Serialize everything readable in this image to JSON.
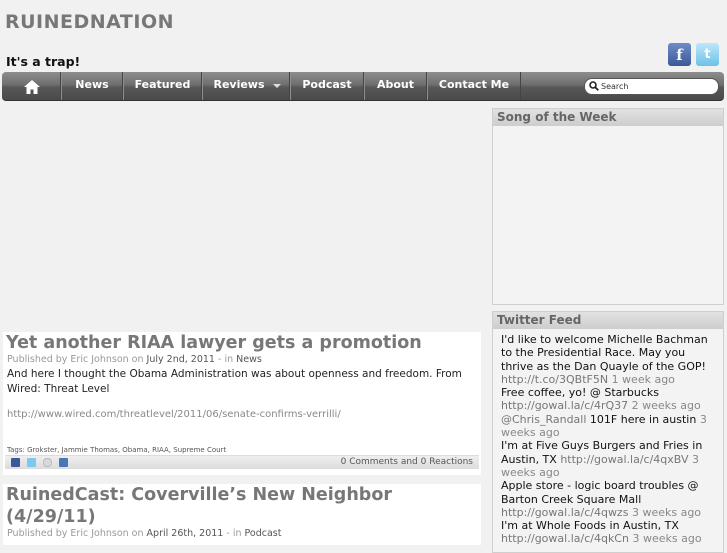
{
  "site": {
    "title": "RUINEDNATION",
    "tagline": "It's a trap!"
  },
  "social": {
    "facebook_glyph": "f",
    "twitter_glyph": "t"
  },
  "nav": {
    "items": [
      {
        "label": "News"
      },
      {
        "label": "Featured"
      },
      {
        "label": "Reviews"
      },
      {
        "label": "Podcast"
      },
      {
        "label": "About"
      },
      {
        "label": "Contact Me"
      }
    ],
    "search_placeholder": "Search"
  },
  "sidebar": {
    "song_title": "Song of the Week",
    "twitter_title": "Twitter Feed",
    "tweets": [
      {
        "text": "I'd like to welcome Michelle Bachman to the Presidential Race. May you thrive as the Dan Quayle of the GOP!",
        "link": "http://t.co/3QBtF5N",
        "time": "1 week ago"
      },
      {
        "text": "Free coffee, yo! @ Starbucks",
        "link": "http://gowal.la/c/4rQ37",
        "time": "2 weeks ago"
      },
      {
        "text": "101F here in austin",
        "mention": "@Chris_Randall",
        "time": "3 weeks ago"
      },
      {
        "text": "I'm at Five Guys Burgers and Fries in Austin, TX",
        "link": "http://gowal.la/c/4qxBV",
        "time": "3 weeks ago"
      },
      {
        "text": "Apple store - logic board troubles @ Barton Creek Square Mall",
        "link": "http://gowal.la/c/4qwzs",
        "time": "3 weeks ago"
      },
      {
        "text": "I'm at Whole Foods in Austin, TX",
        "link": "http://gowal.la/c/4qkCn",
        "time": "3 weeks ago"
      }
    ]
  },
  "posts": [
    {
      "title": "Yet another RIAA lawyer gets a promotion",
      "meta_prefix": "Published by Eric Johnson on",
      "date": "July 2nd, 2011",
      "meta_in": "- in",
      "category": "News",
      "body": "And here I thought the Obama Administration was about openness and freedom. From Wired: Threat Level",
      "link": "http://www.wired.com/threatlevel/2011/06/senate-confirms-verrilli/",
      "tags_label": "Tags:",
      "tags": [
        "Grokster",
        "Jammie Thomas",
        "Obama",
        "RIAA",
        "Supreme Court"
      ],
      "comments": "0 Comments and 0 Reactions"
    },
    {
      "title": "RuinedCast: Coverville’s New Neighbor (4/29/11)",
      "meta_prefix": "Published by Eric Johnson on",
      "date": "April 26th, 2011",
      "meta_in": "- in",
      "category": "Podcast"
    }
  ]
}
